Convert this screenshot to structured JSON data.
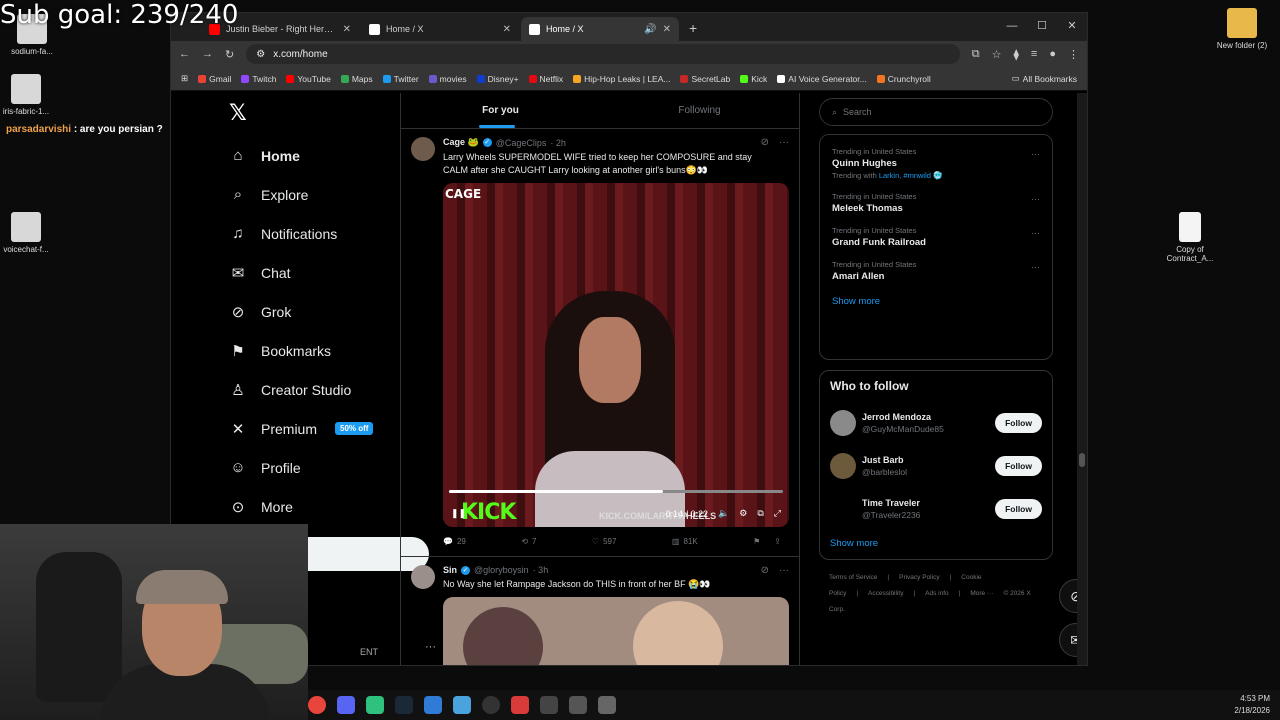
{
  "stream": {
    "goal_text": "Sub goal: 239/240",
    "chat_user": "parsadarvishi",
    "chat_message": " : are you persian ?"
  },
  "desktop": {
    "icons": [
      {
        "label": "sodium-fa...",
        "icon": "java-icon"
      },
      {
        "label": "iris-fabric-1...",
        "icon": "java-icon"
      },
      {
        "label": "voicechat-f...",
        "icon": "java-icon"
      },
      {
        "label": "New folder (2)",
        "icon": "folder-icon"
      },
      {
        "label": "Copy of Contract_A...",
        "icon": "document-icon"
      }
    ]
  },
  "browser": {
    "tabs": [
      {
        "title": "Justin Bieber - Right Here ft. Dr",
        "close": "✕",
        "active": false
      },
      {
        "title": "Home / X",
        "close": "✕",
        "active": false
      },
      {
        "title": "Home / X",
        "close": "✕",
        "active": true
      }
    ],
    "url": "x.com/home",
    "bookmarks": [
      {
        "label": "Gmail",
        "color": "#ea4335"
      },
      {
        "label": "Twitch",
        "color": "#9146ff"
      },
      {
        "label": "YouTube",
        "color": "#ff0000"
      },
      {
        "label": "Maps",
        "color": "#34a853"
      },
      {
        "label": "Twitter",
        "color": "#1d9bf0"
      },
      {
        "label": "movies",
        "color": "#6a5acd"
      },
      {
        "label": "Disney+",
        "color": "#113ccf"
      },
      {
        "label": "Netflix",
        "color": "#e50914"
      },
      {
        "label": "Hip-Hop Leaks | LEA...",
        "color": "#f5a623"
      },
      {
        "label": "SecretLab",
        "color": "#c62828"
      },
      {
        "label": "Kick",
        "color": "#53fc18"
      },
      {
        "label": "AI Voice Generator...",
        "color": "#ffffff"
      },
      {
        "label": "Crunchyroll",
        "color": "#f47521"
      }
    ],
    "all_bookmarks": "All Bookmarks"
  },
  "nav": {
    "items": [
      {
        "label": "Home",
        "icon": "home-icon",
        "glyph": "⌂"
      },
      {
        "label": "Explore",
        "icon": "search-icon",
        "glyph": "⌕"
      },
      {
        "label": "Notifications",
        "icon": "bell-icon",
        "glyph": "♫"
      },
      {
        "label": "Chat",
        "icon": "mail-icon",
        "glyph": "✉"
      },
      {
        "label": "Grok",
        "icon": "grok-icon",
        "glyph": "⊘"
      },
      {
        "label": "Bookmarks",
        "icon": "bookmark-icon",
        "glyph": "⚑"
      },
      {
        "label": "Creator Studio",
        "icon": "creator-icon",
        "glyph": "♙"
      },
      {
        "label": "Premium",
        "icon": "x-premium-icon",
        "glyph": "✕"
      },
      {
        "label": "Profile",
        "icon": "profile-icon",
        "glyph": "☺"
      },
      {
        "label": "More",
        "icon": "more-icon",
        "glyph": "⊙"
      }
    ],
    "premium_badge": "50% off",
    "account_tail": "ENT"
  },
  "timeline": {
    "tabs": [
      "For you",
      "Following"
    ],
    "tweets": [
      {
        "name": "Cage 🐸",
        "handle": "@CageClips",
        "time": "· 2h",
        "text": "Larry Wheels SUPERMODEL WIFE tried to keep her COMPOSURE and stay CALM after she CAUGHT Larry looking at another girl's buns😳👀",
        "video": {
          "logo": "CAGE",
          "watermark": "KICK",
          "overlay_url": "KICK.COM/LARRYWHEELS",
          "time": "0:14 / 0:22",
          "progress": 0.64
        },
        "stats": {
          "replies": "29",
          "reposts": "7",
          "likes": "597",
          "views": "81K"
        }
      },
      {
        "name": "Sin",
        "handle": "@gloryboysin",
        "time": "· 3h",
        "text": "No Way she let Rampage Jackson do THIS in front of her BF 😭👀"
      }
    ]
  },
  "right": {
    "search_placeholder": "Search",
    "trends": [
      {
        "meta": "Trending in United States",
        "title": "Quinn Hughes",
        "sub": "Trending with ",
        "links": "Larkin, #mnwild 🥶"
      },
      {
        "meta": "Trending in United States",
        "title": "Meleek Thomas"
      },
      {
        "meta": "Trending in United States",
        "title": "Grand Funk Railroad"
      },
      {
        "meta": "Trending in United States",
        "title": "Amari Allen"
      }
    ],
    "show_more": "Show more",
    "who_to_follow": {
      "title": "Who to follow",
      "accounts": [
        {
          "name": "Jerrod Mendoza",
          "handle": "@GuyMcManDude85",
          "button": "Follow",
          "color": "#8a8a8a"
        },
        {
          "name": "Just Barb",
          "handle": "@barbleslol",
          "button": "Follow",
          "color": "#6d5a3c"
        },
        {
          "name": "Time Traveler",
          "handle": "@Traveler2236",
          "button": "Follow",
          "color": "#000000"
        }
      ],
      "show_more": "Show more"
    },
    "footer": [
      "Terms of Service",
      "|",
      "Privacy Policy",
      "|",
      "Cookie Policy",
      "|",
      "Accessibility",
      "|",
      "Ads info",
      "|",
      "More ···",
      "© 2026 X Corp."
    ]
  },
  "taskbar": {
    "time": "4:53 PM",
    "date": "2/18/2026"
  }
}
